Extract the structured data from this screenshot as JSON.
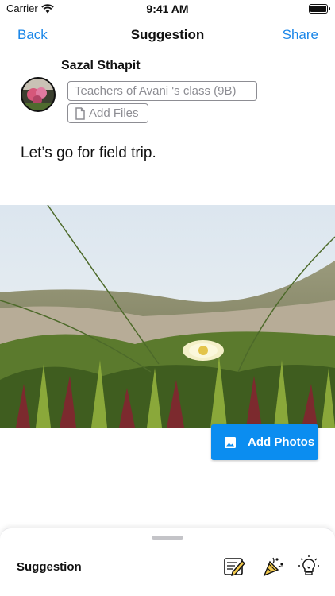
{
  "status_bar": {
    "carrier": "Carrier",
    "time": "9:41 AM"
  },
  "nav": {
    "back_label": "Back",
    "title": "Suggestion",
    "share_label": "Share"
  },
  "post": {
    "author": "Sazal Sthapit",
    "audience": "Teachers of Avani 's class (9B)",
    "add_files_label": "Add Files",
    "text": "Let’s go for field trip."
  },
  "photo": {
    "add_photos_label": "Add Photos",
    "accent_color": "#0b8df0"
  },
  "bottom_sheet": {
    "label": "Suggestion",
    "tools": [
      "note-edit-icon",
      "party-popper-icon",
      "lightbulb-icon"
    ]
  },
  "colors": {
    "link": "#1a86e8",
    "chip_border": "#8d8d93"
  }
}
